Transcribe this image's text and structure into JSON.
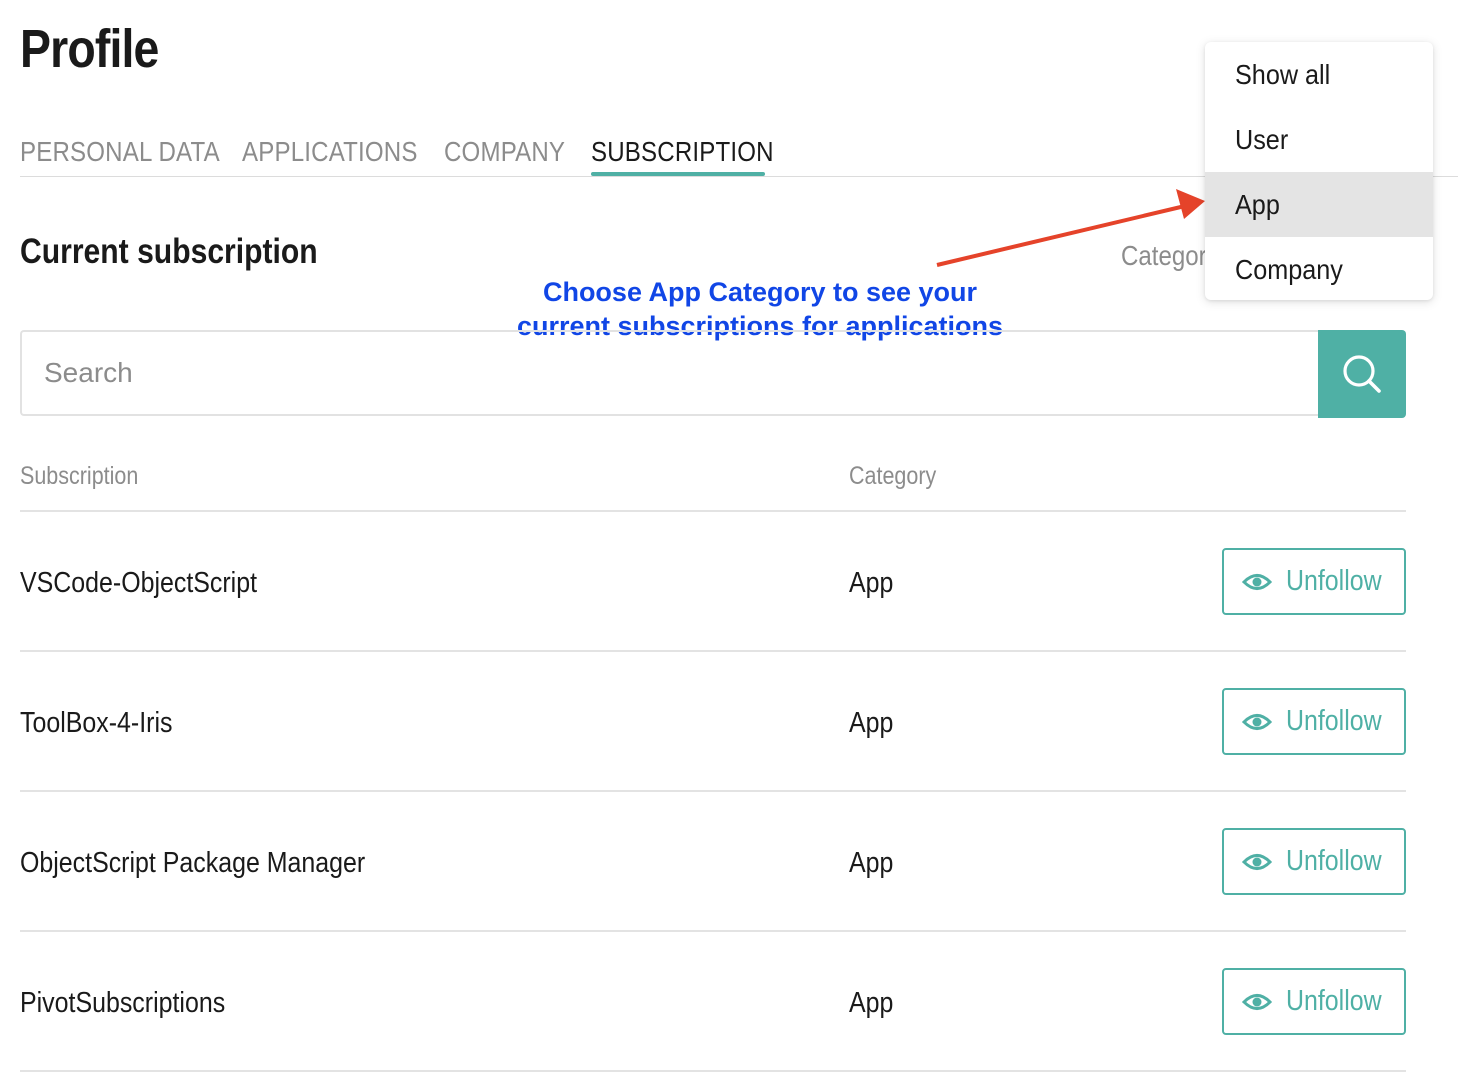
{
  "page": {
    "title": "Profile"
  },
  "tabs": [
    {
      "label": "PERSONAL DATA"
    },
    {
      "label": "APPLICATIONS"
    },
    {
      "label": "COMPANY"
    },
    {
      "label": "SUBSCRIPTION"
    }
  ],
  "active_tab": "SUBSCRIPTION",
  "section": {
    "title": "Current subscription"
  },
  "filter": {
    "label": "Category"
  },
  "annotation": {
    "line1": "Choose App Category to see your",
    "line2": "current subscriptions for applications"
  },
  "search": {
    "placeholder": "Search",
    "value": ""
  },
  "table": {
    "headers": {
      "subscription": "Subscription",
      "category": "Category"
    },
    "rows": [
      {
        "name": "VSCode-ObjectScript",
        "category": "App",
        "action": "Unfollow"
      },
      {
        "name": "ToolBox-4-Iris",
        "category": "App",
        "action": "Unfollow"
      },
      {
        "name": "ObjectScript Package Manager",
        "category": "App",
        "action": "Unfollow"
      },
      {
        "name": "PivotSubscriptions",
        "category": "App",
        "action": "Unfollow"
      }
    ]
  },
  "dropdown": {
    "options": [
      "Show all",
      "User",
      "App",
      "Company"
    ],
    "selected": "App"
  },
  "icons": {
    "search": "search-icon",
    "eye": "eye-icon",
    "arrow": "arrow-annotation"
  },
  "colors": {
    "accent": "#4fb0a5",
    "annotation": "#1146e6",
    "arrow": "#e5432a",
    "muted_text": "#8c8c8c"
  }
}
